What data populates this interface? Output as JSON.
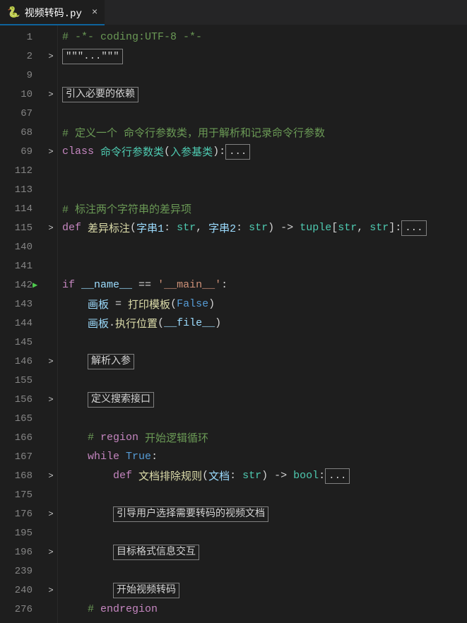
{
  "tab": {
    "icon": "🐍",
    "filename": "视频转码.py",
    "close": "×"
  },
  "lines": [
    {
      "num": "1",
      "fold": "",
      "run": false,
      "kind": "comment",
      "text": "# -*- coding:UTF-8 -*-"
    },
    {
      "num": "2",
      "fold": ">",
      "run": false,
      "kind": "foldbox",
      "pre": "",
      "box": "\"\"\"...\"\"\""
    },
    {
      "num": "9",
      "fold": "",
      "run": false,
      "kind": "blank",
      "text": ""
    },
    {
      "num": "10",
      "fold": ">",
      "run": false,
      "kind": "foldbox",
      "pre": "",
      "box": "引入必要的依赖"
    },
    {
      "num": "67",
      "fold": "",
      "run": false,
      "kind": "blank",
      "text": ""
    },
    {
      "num": "68",
      "fold": "",
      "run": false,
      "kind": "comment",
      "text": "# 定义一个 命令行参数类，用于解析和记录命令行参数"
    },
    {
      "num": "69",
      "fold": ">",
      "run": false,
      "kind": "classdef"
    },
    {
      "num": "112",
      "fold": "",
      "run": false,
      "kind": "blank",
      "text": ""
    },
    {
      "num": "113",
      "fold": "",
      "run": false,
      "kind": "blank",
      "text": ""
    },
    {
      "num": "114",
      "fold": "",
      "run": false,
      "kind": "comment",
      "text": "# 标注两个字符串的差异项"
    },
    {
      "num": "115",
      "fold": ">",
      "run": false,
      "kind": "funcdef1"
    },
    {
      "num": "140",
      "fold": "",
      "run": false,
      "kind": "blank",
      "text": ""
    },
    {
      "num": "141",
      "fold": "",
      "run": false,
      "kind": "blank",
      "text": ""
    },
    {
      "num": "142",
      "fold": "",
      "run": true,
      "kind": "ifmain"
    },
    {
      "num": "143",
      "fold": "",
      "run": false,
      "kind": "assign1"
    },
    {
      "num": "144",
      "fold": "",
      "run": false,
      "kind": "call1"
    },
    {
      "num": "145",
      "fold": "",
      "run": false,
      "kind": "blank",
      "text": ""
    },
    {
      "num": "146",
      "fold": ">",
      "run": false,
      "kind": "foldbox",
      "pre": "    ",
      "box": "解析入参"
    },
    {
      "num": "155",
      "fold": "",
      "run": false,
      "kind": "blank",
      "text": ""
    },
    {
      "num": "156",
      "fold": ">",
      "run": false,
      "kind": "foldbox",
      "pre": "    ",
      "box": "定义搜索接口"
    },
    {
      "num": "165",
      "fold": "",
      "run": false,
      "kind": "blank",
      "text": ""
    },
    {
      "num": "166",
      "fold": "",
      "run": false,
      "kind": "region"
    },
    {
      "num": "167",
      "fold": "",
      "run": false,
      "kind": "while"
    },
    {
      "num": "168",
      "fold": ">",
      "run": false,
      "kind": "funcdef2"
    },
    {
      "num": "175",
      "fold": "",
      "run": false,
      "kind": "blank",
      "text": ""
    },
    {
      "num": "176",
      "fold": ">",
      "run": false,
      "kind": "foldbox",
      "pre": "        ",
      "box": "引导用户选择需要转码的视频文档"
    },
    {
      "num": "195",
      "fold": "",
      "run": false,
      "kind": "blank",
      "text": ""
    },
    {
      "num": "196",
      "fold": ">",
      "run": false,
      "kind": "foldbox",
      "pre": "        ",
      "box": "目标格式信息交互"
    },
    {
      "num": "239",
      "fold": "",
      "run": false,
      "kind": "blank",
      "text": ""
    },
    {
      "num": "240",
      "fold": ">",
      "run": false,
      "kind": "foldbox",
      "pre": "        ",
      "box": "开始视频转码"
    },
    {
      "num": "276",
      "fold": "",
      "run": false,
      "kind": "endregion"
    }
  ],
  "tokens": {
    "classdef": {
      "kw": "class",
      "name": "命令行参数类",
      "paren_in": "(",
      "base": "入参基类",
      "paren_out": "):",
      "ell": "..."
    },
    "funcdef1": {
      "kw": "def",
      "name": "差异标注",
      "p1": "(",
      "a1": "字串1",
      "col1": ": ",
      "t1": "str",
      "com": ", ",
      "a2": "字串2",
      "col2": ": ",
      "t2": "str",
      "p2": ") -> ",
      "ret": "tuple",
      "rb1": "[",
      "rt1": "str",
      "rcom": ", ",
      "rt2": "str",
      "rb2": "]:",
      "ell": "..."
    },
    "ifmain": {
      "kw": "if",
      "var": "__name__",
      "eq": " == ",
      "str": "'__main__'",
      "colon": ":"
    },
    "assign1": {
      "indent": "    ",
      "var": "画板",
      "eq": " = ",
      "fn": "打印模板",
      "p1": "(",
      "val": "False",
      "p2": ")"
    },
    "call1": {
      "indent": "    ",
      "obj": "画板",
      "dot": ".",
      "meth": "执行位置",
      "p1": "(",
      "arg": "__file__",
      "p2": ")"
    },
    "region": {
      "indent": "    ",
      "hash": "# ",
      "kw": "region",
      "text": " 开始逻辑循环"
    },
    "while": {
      "indent": "    ",
      "kw": "while",
      "sp": " ",
      "val": "True",
      "colon": ":"
    },
    "funcdef2": {
      "indent": "        ",
      "kw": "def",
      "name": "文档排除规则",
      "p1": "(",
      "a1": "文档",
      "col": ": ",
      "t1": "str",
      "p2": ") -> ",
      "ret": "bool",
      "colon": ":",
      "ell": "..."
    },
    "endregion": {
      "indent": "    ",
      "hash": "# ",
      "kw": "endregion"
    }
  }
}
